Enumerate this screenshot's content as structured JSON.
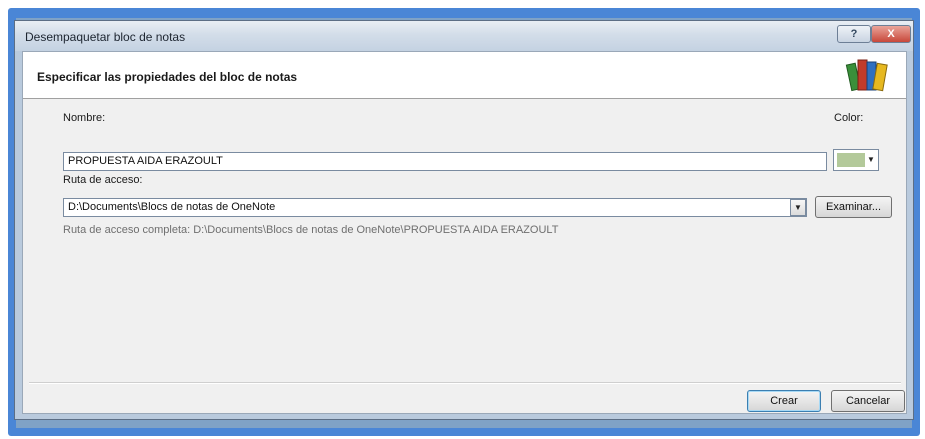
{
  "window": {
    "title": "Desempaquetar bloc de notas",
    "help_label": "?",
    "close_label": "X"
  },
  "header": {
    "title": "Especificar las propiedades del bloc de notas",
    "logo_icon": "onenote-notebooks-icon"
  },
  "name_field": {
    "label": "Nombre:",
    "value": "PROPUESTA AIDA ERAZOULT"
  },
  "color_field": {
    "label": "Color:",
    "value_color": "#b3c99a"
  },
  "path_field": {
    "label": "Ruta de acceso:",
    "value": "D:\\Documents\\Blocs de notas de OneNote",
    "browse_label": "Examinar..."
  },
  "full_path": {
    "text": "Ruta de acceso completa: D:\\Documents\\Blocs de notas de OneNote\\PROPUESTA AIDA ERAZOULT"
  },
  "footer": {
    "create_label": "Crear",
    "cancel_label": "Cancelar"
  }
}
